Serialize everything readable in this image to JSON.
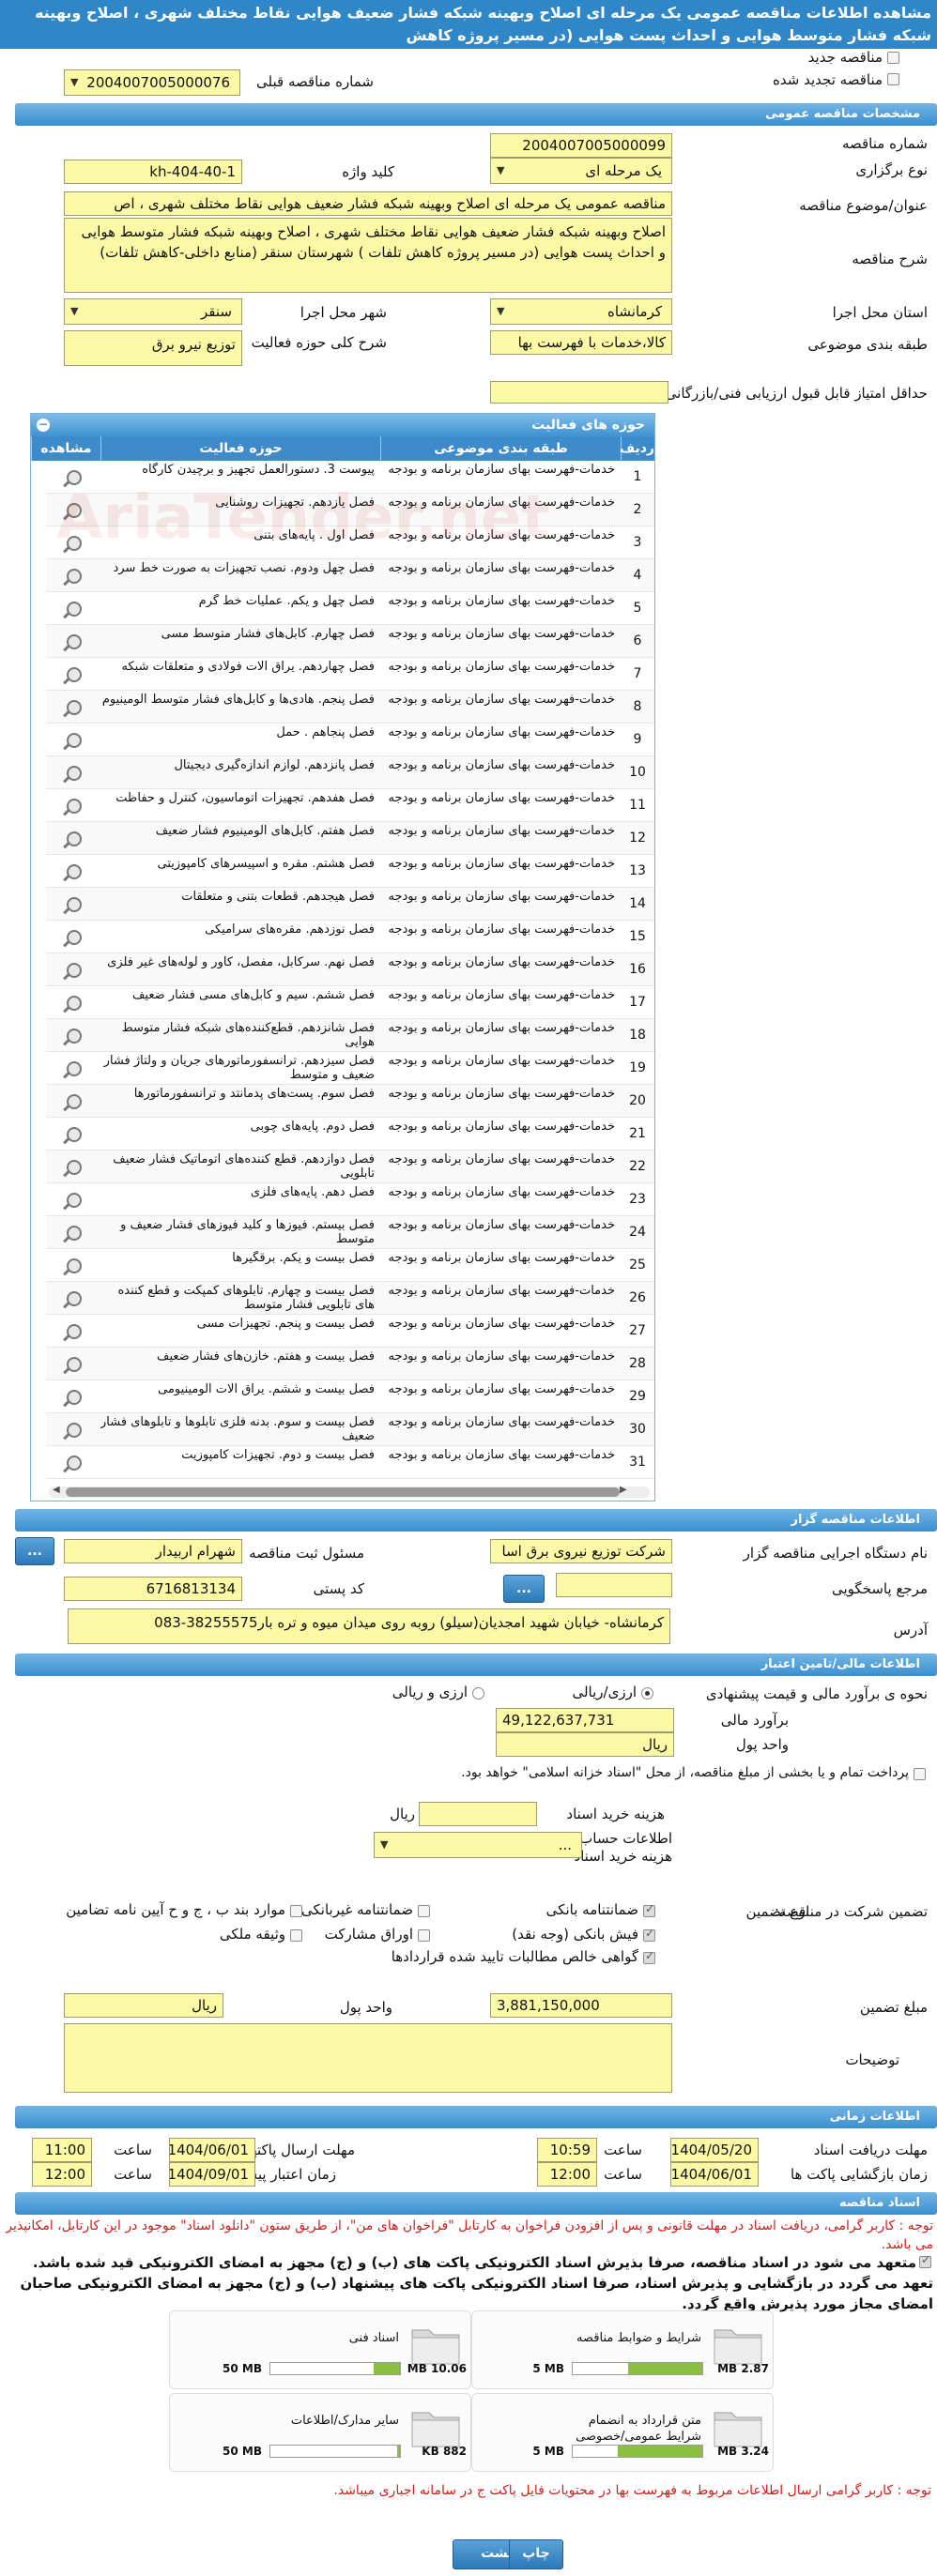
{
  "title": "مشاهده اطلاعات مناقصه عمومی یک مرحله ای اصلاح وبهینه شبکه فشار ضعیف هوایی نقاط مختلف شهری ، اصلاح وبهینه شبکه فشار متوسط هوایی و احداث پست هوایی (در مسیر پروژه کاهش",
  "top": {
    "new_tender": "مناقصه جدید",
    "renewed_tender": "مناقصه تجدید شده",
    "prev_tender_label": "شماره مناقصه قبلی",
    "prev_tender_value": "2004007005000076"
  },
  "sections": {
    "general": "مشخصات مناقصه عمومی",
    "activity": "حوزه های فعالیت",
    "organizer": "اطلاعات مناقصه گزار",
    "finance": "اطلاعات مالی/تامین اعتبار",
    "timing": "اطلاعات زمانی",
    "docs": "اسناد مناقصه"
  },
  "general": {
    "tender_no_label": "شماره مناقصه",
    "tender_no": "2004007005000099",
    "type_label": "نوع برگزاری",
    "type": "یک مرحله ای",
    "keyword_label": "کلید واژه",
    "keyword": "kh-404-40-1",
    "subject_label": "عنوان/موضوع مناقصه",
    "subject": "مناقصه عمومی یک مرحله ای اصلاح وبهینه شبکه فشار ضعیف هوایی نقاط مختلف شهری ، اص",
    "desc_label": "شرح مناقصه",
    "desc": "اصلاح وبهینه شبکه فشار ضعیف هوایی نقاط مختلف شهری ، اصلاح وبهینه شبکه فشار متوسط هوایی و احداث پست هوایی  (در مسیر پروژه کاهش تلفات ) شهرستان سنقر (منابع داخلی-کاهش تلفات)",
    "province_label": "استان محل اجرا",
    "province": "کرمانشاه",
    "city_label": "شهر محل اجرا",
    "city": "سنقر",
    "category_label": "طبقه بندی موضوعی",
    "category": "کالا،خدمات با فهرست بها",
    "scope_label": "شرح کلی حوزه فعالیت",
    "scope": "توزیع نیرو برق",
    "min_score_label": "حداقل امتیاز قابل قبول ارزیابی فنی/بازرگانی",
    "min_score": ""
  },
  "grid": {
    "cols": {
      "row": "ردیف",
      "category": "طبقه بندی موضوعی",
      "activity": "حوزه فعالیت",
      "view": "مشاهده"
    },
    "rows": [
      {
        "n": "1",
        "cat": "خدمات-فهرست بهای سازمان برنامه و بودجه",
        "act": "پیوست 3. دستورالعمل تجهیز و برچیدن کارگاه"
      },
      {
        "n": "2",
        "cat": "خدمات-فهرست بهای سازمان برنامه و بودجه",
        "act": "فصل یازدهم. تجهیزات روشنایی"
      },
      {
        "n": "3",
        "cat": "خدمات-فهرست بهای سازمان برنامه و بودجه",
        "act": "فصل اول . پایه‌های بتنی"
      },
      {
        "n": "4",
        "cat": "خدمات-فهرست بهای سازمان برنامه و بودجه",
        "act": "فصل چهل ودوم. نصب تجهیزات به صورت خط سرد"
      },
      {
        "n": "5",
        "cat": "خدمات-فهرست بهای سازمان برنامه و بودجه",
        "act": "فصل چهل و یکم. عملیات خط گرم"
      },
      {
        "n": "6",
        "cat": "خدمات-فهرست بهای سازمان برنامه و بودجه",
        "act": "فصل چهارم. کابل‌های فشار متوسط مسی"
      },
      {
        "n": "7",
        "cat": "خدمات-فهرست بهای سازمان برنامه و بودجه",
        "act": "فصل چهاردهم. یراق آلات فولادی و متعلقات شبکه"
      },
      {
        "n": "8",
        "cat": "خدمات-فهرست بهای سازمان برنامه و بودجه",
        "act": "فصل پنجم. هادی‌ها و کابل‌های فشار متوسط آلومینیوم"
      },
      {
        "n": "9",
        "cat": "خدمات-فهرست بهای سازمان برنامه و بودجه",
        "act": "فصل پنجاهم . حمل"
      },
      {
        "n": "10",
        "cat": "خدمات-فهرست بهای سازمان برنامه و بودجه",
        "act": "فصل پانزدهم. لوازم اندازه‌گیری دیجیتال"
      },
      {
        "n": "11",
        "cat": "خدمات-فهرست بهای سازمان برنامه و بودجه",
        "act": "فصل هفدهم. تجهیزات اتوماسیون، کنترل و حفاظت"
      },
      {
        "n": "12",
        "cat": "خدمات-فهرست بهای سازمان برنامه و بودجه",
        "act": "فصل هفتم. کابل‌های آلومینیوم فشار ضعیف"
      },
      {
        "n": "13",
        "cat": "خدمات-فهرست بهای سازمان برنامه و بودجه",
        "act": "فصل هشتم. مقره و اسپیسرهای کامپوزیتی"
      },
      {
        "n": "14",
        "cat": "خدمات-فهرست بهای سازمان برنامه و بودجه",
        "act": "فصل هیجدهم. قطعات بتنی و متعلقات"
      },
      {
        "n": "15",
        "cat": "خدمات-فهرست بهای سازمان برنامه و بودجه",
        "act": "فصل نوزدهم. مقره‌های سرامیکی"
      },
      {
        "n": "16",
        "cat": "خدمات-فهرست بهای سازمان برنامه و بودجه",
        "act": "فصل نهم. سرکابل، مفصل، کاور و لوله‌های غیر فلزی"
      },
      {
        "n": "17",
        "cat": "خدمات-فهرست بهای سازمان برنامه و بودجه",
        "act": "فصل ششم. سیم و کابل‌های مسی فشار ضعیف"
      },
      {
        "n": "18",
        "cat": "خدمات-فهرست بهای سازمان برنامه و بودجه",
        "act": "فصل شانزدهم. قطع‌کننده‌های شبکه فشار متوسط هوایی"
      },
      {
        "n": "19",
        "cat": "خدمات-فهرست بهای سازمان برنامه و بودجه",
        "act": "فصل سیزدهم. ترانسفورماتورهای جریان و ولتاژ فشار ضعیف و متوسط"
      },
      {
        "n": "20",
        "cat": "خدمات-فهرست بهای سازمان برنامه و بودجه",
        "act": "فصل سوم. پست‌های پدمانتد و ترانسفورماتورها"
      },
      {
        "n": "21",
        "cat": "خدمات-فهرست بهای سازمان برنامه و بودجه",
        "act": "فصل دوم. پایه‌های چوبی"
      },
      {
        "n": "22",
        "cat": "خدمات-فهرست بهای سازمان برنامه و بودجه",
        "act": "فصل دوازدهم. قطع کننده‌های اتوماتیک فشار ضعیف تابلویی"
      },
      {
        "n": "23",
        "cat": "خدمات-فهرست بهای سازمان برنامه و بودجه",
        "act": "فصل دهم. پایه‌های فلزی"
      },
      {
        "n": "24",
        "cat": "خدمات-فهرست بهای سازمان برنامه و بودجه",
        "act": "فصل بیستم. فیوزها و کلید فیوزهای فشار ضعیف و متوسط"
      },
      {
        "n": "25",
        "cat": "خدمات-فهرست بهای سازمان برنامه و بودجه",
        "act": "فصل بیست و یکم. برقگیرها"
      },
      {
        "n": "26",
        "cat": "خدمات-فهرست بهای سازمان برنامه و بودجه",
        "act": "فصل بیست و چهارم. تابلوهای کمپکت و قطع کننده های تابلویی فشار متوسط"
      },
      {
        "n": "27",
        "cat": "خدمات-فهرست بهای سازمان برنامه و بودجه",
        "act": "فصل بیست و پنجم. تجهیزات مسی"
      },
      {
        "n": "28",
        "cat": "خدمات-فهرست بهای سازمان برنامه و بودجه",
        "act": "فصل بیست و هفتم. خازن‌های فشار ضعیف"
      },
      {
        "n": "29",
        "cat": "خدمات-فهرست بهای سازمان برنامه و بودجه",
        "act": "فصل بیست و ششم. یراق آلات آلومینیومی"
      },
      {
        "n": "30",
        "cat": "خدمات-فهرست بهای سازمان برنامه و بودجه",
        "act": "فصل بیست و سوم. بدنه فلزی تابلوها و تابلوهای فشار ضعیف"
      },
      {
        "n": "31",
        "cat": "خدمات-فهرست بهای سازمان برنامه و بودجه",
        "act": "فصل بیست و دوم. تجهیزات کامپوزیت"
      }
    ]
  },
  "organizer": {
    "org_label": "نام دستگاه اجرایی مناقصه گزار",
    "org": "شرکت توزیع نیروی برق اسا",
    "reg_label": "مسئول ثبت مناقصه",
    "reg": "شهرام اربیدار",
    "ref_label": "مرجع پاسخگویی",
    "ref": "",
    "postal_label": "کد پستی",
    "postal": "6716813134",
    "address_label": "آدرس",
    "address": "کرمانشاه- خیابان شهید امجدیان(سیلو) روبه روی میدان میوه و تره بار38255575-083",
    "more_btn": "..."
  },
  "finance": {
    "estimate_label": "نحوه ی برآورد مالی و قیمت پیشنهادی",
    "opt_rial": "ارزی/ریالی",
    "opt_fx": "ارزی و ریالی",
    "estimate_amount_label": "برآورد مالی",
    "estimate_amount": "49,122,637,731",
    "unit_label": "واحد پول",
    "unit": "ریال",
    "treasury_label": "پرداخت تمام و یا بخشی از مبلغ مناقصه، از محل \"اسناد خزانه اسلامی\" خواهد بود.",
    "doc_fee_label": "هزینه خرید اسناد",
    "doc_fee": "",
    "doc_fee_unit": "ریال",
    "account_label": "اطلاعات حساب جهت واریز هزینه خرید اسناد",
    "account": "...",
    "guar_type_label": "نوع تضمین",
    "guar_label": "تضمین شرکت در مناقصه:",
    "g1": "ضمانتنامه بانکی",
    "g2": "ضمانتنامه غیربانکی",
    "g3": "موارد بند ب ، ج و ح آیین نامه تضامین",
    "g4": "فیش بانکی (وجه نقد)",
    "g5": "اوراق مشارکت",
    "g6": "وثیقه ملکی",
    "g7": "گواهی خالص مطالبات تایید شده قراردادها",
    "guar_amount_label": "مبلغ تضمین",
    "guar_amount": "3,881,150,000",
    "guar_unit_label": "واحد پول",
    "guar_unit": "ریال",
    "notes_label": "توضیحات",
    "notes": ""
  },
  "timing": {
    "receive_label": "مهلت دریافت اسناد",
    "receive_date": "1404/05/20",
    "receive_time": "10:59",
    "submit_label": "مهلت ارسال پاکتهای پیشنهاد",
    "submit_date": "1404/06/01",
    "submit_time": "11:00",
    "open_label": "زمان بازگشایی پاکت ها",
    "open_date": "1404/06/01",
    "open_time": "12:00",
    "valid_label": "زمان اعتبار پیشنهاد",
    "valid_date": "1404/09/01",
    "valid_time": "12:00",
    "time_label": "ساعت"
  },
  "docs": {
    "note1": "توجه : کاربر گرامی، دریافت اسناد در مهلت قانونی و پس از افزودن فراخوان به کارتابل \"فراخوان های من\"، از طریق ستون \"دانلود اسناد\" موجود در این کارتابل، امکانپذیر می باشد.",
    "note2": "متعهد می شود در اسناد مناقصه، صرفا بذیرش اسناد الکترونیکی پاکت های (ب) و (ج) مجهز به امضای الکترونیکی قید شده باشد. تعهد می گردد در بازگشایی و پذیرش اسناد، صرفا اسناد الکترونیکی پاکت های پیشنهاد (ب) و (ج) مجهز به امضای الکترونیکی صاحبان امضای مجاز مورد پذیرش واقع گردد.",
    "cards": [
      {
        "title": "شرایط و ضوابط مناقصه",
        "size": "2.87 MB",
        "max": "5 MB",
        "pct": 0.57
      },
      {
        "title": "اسناد فنی",
        "size": "10.06 MB",
        "max": "50 MB",
        "pct": 0.2
      },
      {
        "title": "متن قرارداد به انضمام شرایط عمومی/خصوصی",
        "size": "3.24 MB",
        "max": "5 MB",
        "pct": 0.65
      },
      {
        "title": "سایر مدارک/اطلاعات",
        "size": "882 KB",
        "max": "50 MB",
        "pct": 0.02
      }
    ],
    "note3": "توجه : کاربر گرامی ارسال اطلاعات مربوط به فهرست بها در محتویات فایل پاکت ج در سامانه اجباری میباشد."
  },
  "buttons": {
    "print": "چاپ",
    "back": "بازگشت"
  },
  "watermark": "AriaTender.net"
}
